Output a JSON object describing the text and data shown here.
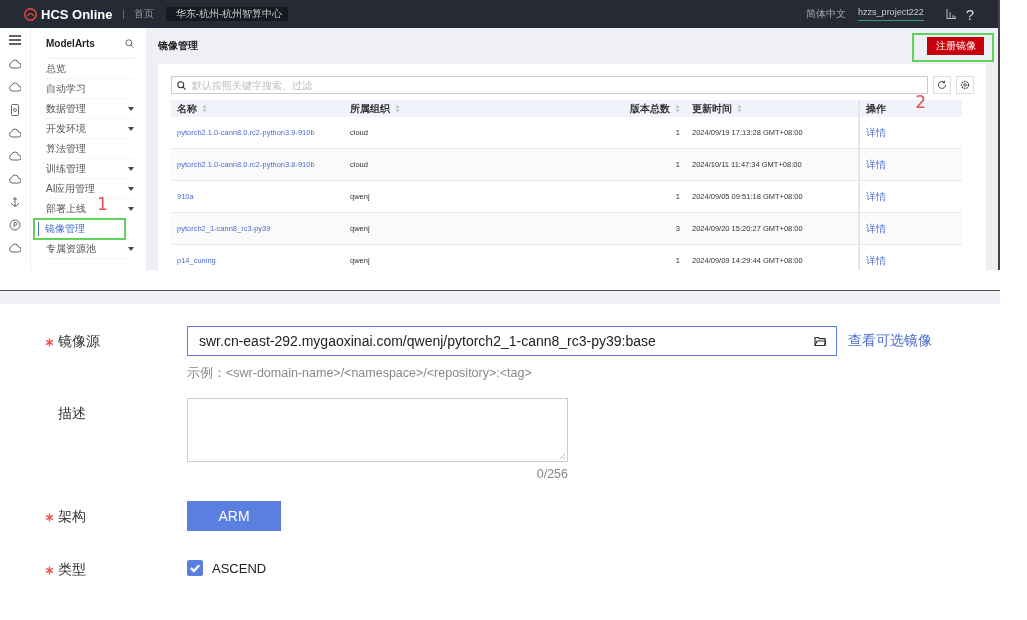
{
  "header": {
    "logo": "HCS Online",
    "home": "首页",
    "region": "华东-杭州-杭州智算中心",
    "language": "简体中文",
    "project": "hzzs_project222",
    "help": "?"
  },
  "sidebar": {
    "title": "ModelArts",
    "items": [
      {
        "label": "总览",
        "expandable": false,
        "selected": false
      },
      {
        "label": "自动学习",
        "expandable": false,
        "selected": false
      },
      {
        "label": "数据管理",
        "expandable": true,
        "selected": false
      },
      {
        "label": "开发环境",
        "expandable": true,
        "selected": false
      },
      {
        "label": "算法管理",
        "expandable": false,
        "selected": false
      },
      {
        "label": "训练管理",
        "expandable": true,
        "selected": false
      },
      {
        "label": "AI应用管理",
        "expandable": true,
        "selected": false
      },
      {
        "label": "部署上线",
        "expandable": true,
        "selected": false
      },
      {
        "label": "镜像管理",
        "expandable": false,
        "selected": true
      },
      {
        "label": "专属资源池",
        "expandable": true,
        "selected": false
      }
    ]
  },
  "page": {
    "title": "镜像管理",
    "register_button": "注册镜像"
  },
  "search": {
    "placeholder": "默认按照关键字搜索、过滤"
  },
  "table": {
    "columns": [
      "名称",
      "所属组织",
      "版本总数",
      "更新时间",
      "操作"
    ],
    "rows": [
      {
        "name": "pytorch2.1.0-cann8.0.rc2-python3.9-910b",
        "org": "cloud",
        "versions": "1",
        "updated": "2024/09/19 17:13:28 GMT+08:00",
        "action": "详情"
      },
      {
        "name": "pytorch2.1.0-cann8.0.rc2-python3.8-910b",
        "org": "cloud",
        "versions": "1",
        "updated": "2024/10/11 11:47:34 GMT+08:00",
        "action": "详情"
      },
      {
        "name": "910a",
        "org": "qwenj",
        "versions": "1",
        "updated": "2024/09/05 09:51:18 GMT+08:00",
        "action": "详情"
      },
      {
        "name": "pytorch2_1-cann8_rc3-py39",
        "org": "qwenj",
        "versions": "3",
        "updated": "2024/09/20 15:20:27 GMT+08:00",
        "action": "详情"
      },
      {
        "name": "p14_cuning",
        "org": "qwenj",
        "versions": "1",
        "updated": "2024/09/09 14:29:44 GMT+08:00",
        "action": "详情"
      }
    ]
  },
  "annotations": [
    {
      "label": "1"
    },
    {
      "label": "2"
    }
  ],
  "form": {
    "fields": [
      {
        "kind": "text",
        "label": "镜像源",
        "required": true,
        "value": "swr.cn-east-292.mygaoxinai.com/qwenj/pytorch2_1-cann8_rc3-py39:base",
        "link": "查看可选镜像",
        "hint": "示例：<swr-domain-name>/<namespace>/<repository>:<tag>"
      },
      {
        "kind": "textarea",
        "label": "描述",
        "required": false,
        "counter": "0/256"
      },
      {
        "kind": "button",
        "label": "架构",
        "required": true,
        "value": "ARM"
      },
      {
        "kind": "checkbox",
        "label": "类型",
        "required": true,
        "value": "ASCEND",
        "checked": true
      }
    ]
  }
}
